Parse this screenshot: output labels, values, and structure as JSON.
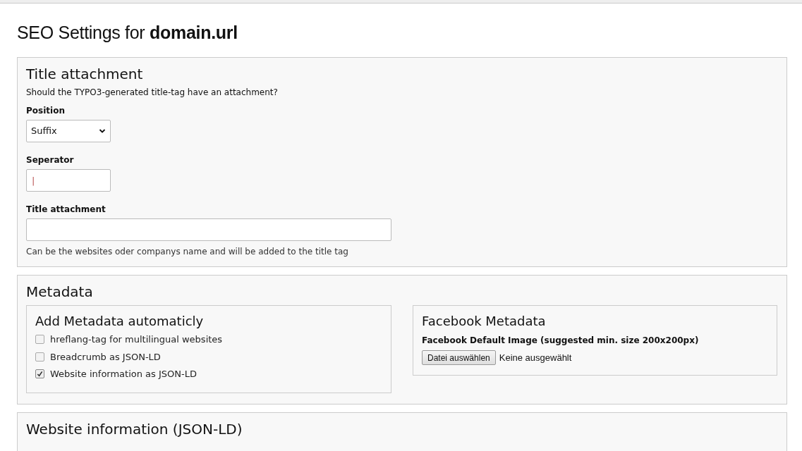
{
  "page_title": "SEO Settings for **domain.url**",
  "title_attachment": {
    "heading": "Title attachment",
    "intro": "Should the TYPO3-generated title-tag have an attachment?",
    "position": {
      "label": "Position",
      "value": "Suffix"
    },
    "separator": {
      "label": "Seperator",
      "value": "|"
    },
    "attachment": {
      "label": "Title attachment",
      "help": "Can be the websites oder companys name and will be added to the title tag"
    }
  },
  "metadata": {
    "heading": "Metadata",
    "auto": {
      "heading": "Add Metadata automaticly",
      "options": [
        {
          "label": "hreflang-tag for multilingual websites",
          "checked": false
        },
        {
          "label": "Breadcrumb as JSON-LD",
          "checked": false
        },
        {
          "label": "Website information as JSON-LD",
          "checked": true
        }
      ]
    },
    "facebook": {
      "heading": "Facebook Metadata",
      "image_label": "Facebook Default Image (suggested min. size 200x200px)",
      "button": "Datei auswählen",
      "file_status": "Keine ausgewählt"
    }
  },
  "website_info": {
    "heading": "Website information (JSON-LD)"
  }
}
